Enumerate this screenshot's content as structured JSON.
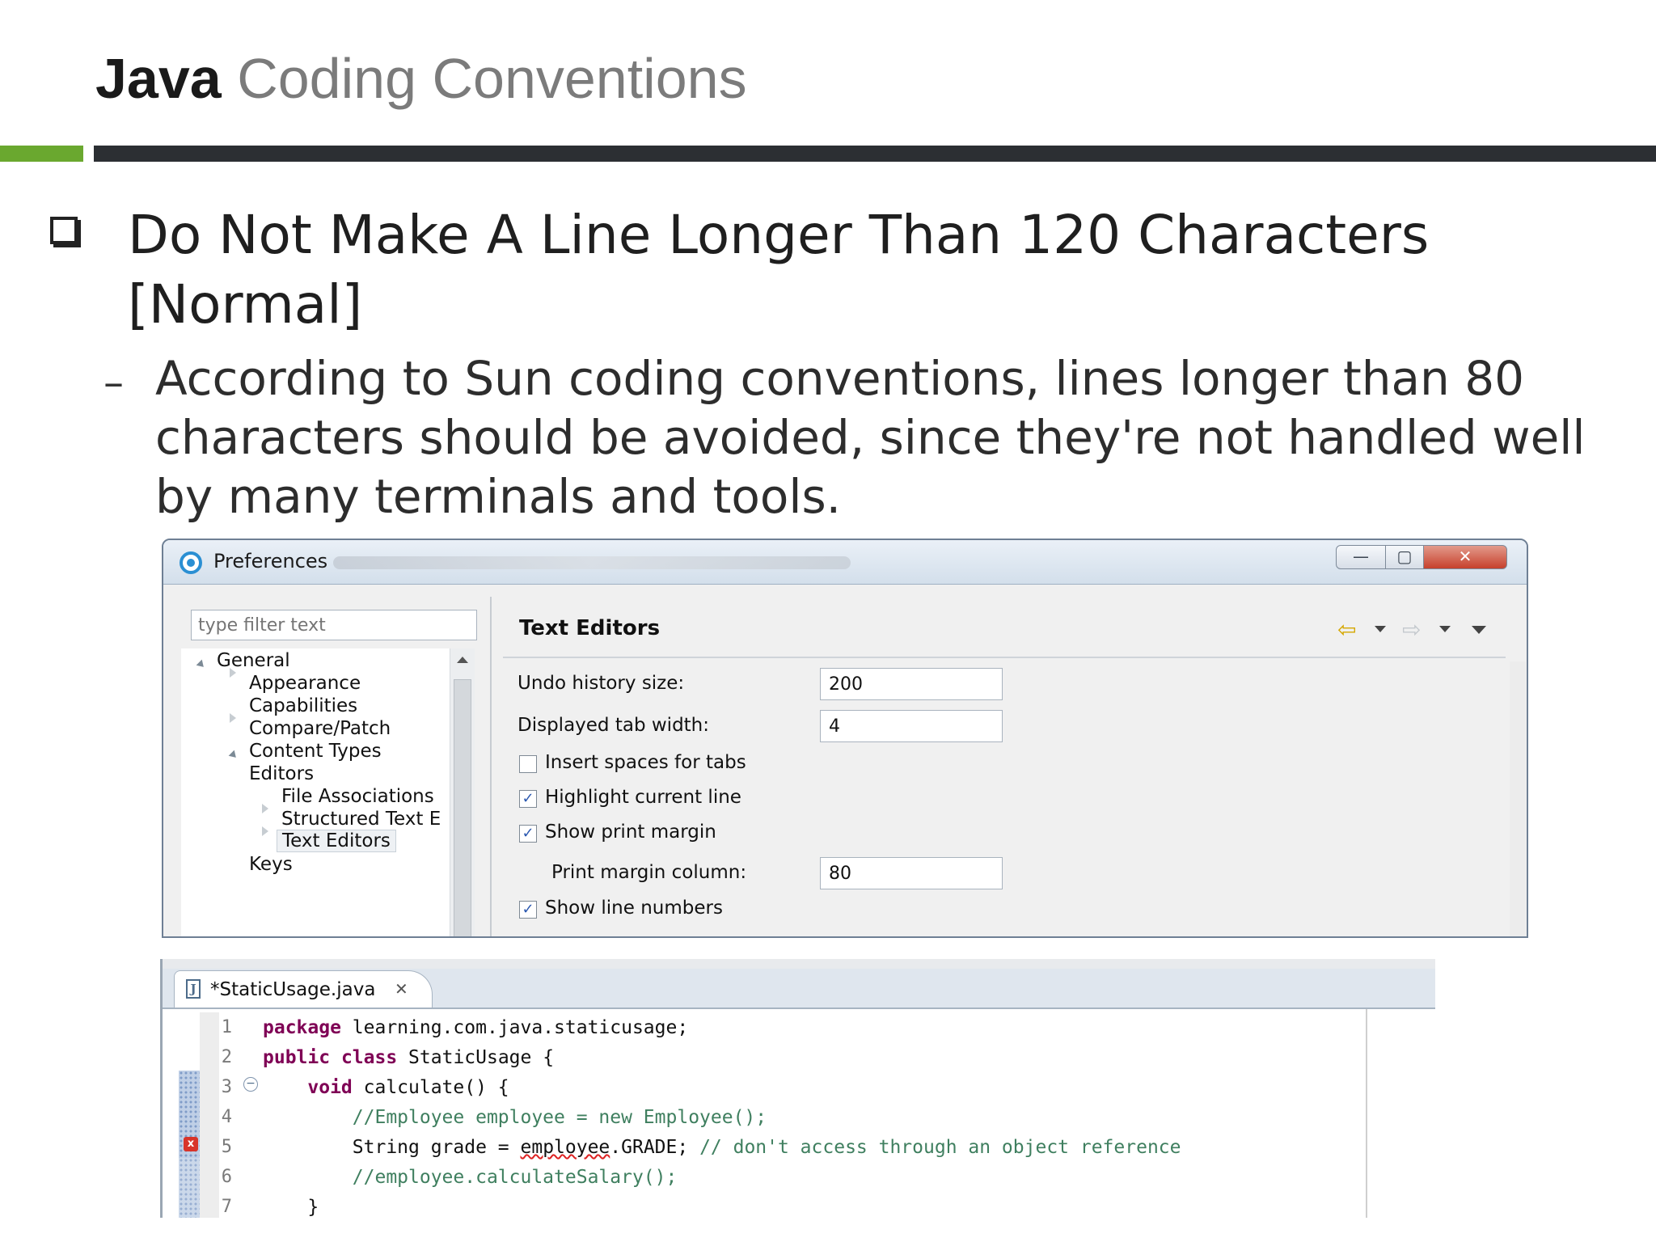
{
  "slide": {
    "title_bold": "Java",
    "title_rest": "Coding Conventions",
    "bullet_main": "Do Not Make A Line Longer Than 120 Characters [Normal]",
    "bullet_sub": "According to Sun coding conventions, lines longer than 80 characters should be avoided, since they're not handled well by many terminals and tools.",
    "accent_colors": {
      "green": "#6aa82f",
      "dark": "#2c2f33"
    }
  },
  "preferences": {
    "window_title": "Preferences",
    "window_buttons": [
      "minimize",
      "maximize",
      "close"
    ],
    "filter_placeholder": "type filter text",
    "tree": [
      {
        "label": "General",
        "level": 0,
        "expanded": true
      },
      {
        "label": "Appearance",
        "level": 1,
        "expandable": true
      },
      {
        "label": "Capabilities",
        "level": 1
      },
      {
        "label": "Compare/Patch",
        "level": 1,
        "expandable": true
      },
      {
        "label": "Content Types",
        "level": 1
      },
      {
        "label": "Editors",
        "level": 1,
        "expanded": true
      },
      {
        "label": "File Associations",
        "level": 2
      },
      {
        "label": "Structured Text E",
        "level": 2,
        "expandable": true
      },
      {
        "label": "Text Editors",
        "level": 2,
        "selected": true,
        "expandable": true
      },
      {
        "label": "Keys",
        "level": 1
      }
    ],
    "page_title": "Text Editors",
    "fields": {
      "undo_label": "Undo history size:",
      "undo_value": "200",
      "tab_width_label": "Displayed tab width:",
      "tab_width_value": "4",
      "insert_spaces_label": "Insert spaces for tabs",
      "insert_spaces_checked": false,
      "highlight_line_label": "Highlight current line",
      "highlight_line_checked": true,
      "print_margin_label": "Show print margin",
      "print_margin_checked": true,
      "print_margin_column_label": "Print margin column:",
      "print_margin_column_value": "80",
      "line_numbers_label": "Show line numbers",
      "line_numbers_checked": true
    }
  },
  "editor": {
    "tab_label": "*StaticUsage.java",
    "lines": [
      {
        "num": "1",
        "parts": [
          [
            "kw",
            "package"
          ],
          [
            "",
            " learning.com.java.staticusage;"
          ]
        ]
      },
      {
        "num": "2",
        "parts": [
          [
            "kw",
            "public"
          ],
          [
            "",
            " "
          ],
          [
            "kw",
            "class"
          ],
          [
            "",
            " StaticUsage {"
          ]
        ]
      },
      {
        "num": "3",
        "parts": [
          [
            "",
            "    "
          ],
          [
            "kw",
            "void"
          ],
          [
            "",
            " calculate() {"
          ]
        ]
      },
      {
        "num": "4",
        "parts": [
          [
            "",
            "        "
          ],
          [
            "cm",
            "//Employee employee = new Employee();"
          ]
        ]
      },
      {
        "num": "5",
        "parts": [
          [
            "",
            "        String grade = "
          ],
          [
            "sq",
            "employee"
          ],
          [
            "",
            ".GRADE; "
          ],
          [
            "cm",
            "// don't access through an object reference"
          ]
        ]
      },
      {
        "num": "6",
        "parts": [
          [
            "",
            "        "
          ],
          [
            "cm",
            "//employee.calculateSalary();"
          ]
        ]
      },
      {
        "num": "7",
        "parts": [
          [
            "",
            "    }"
          ]
        ]
      }
    ]
  }
}
